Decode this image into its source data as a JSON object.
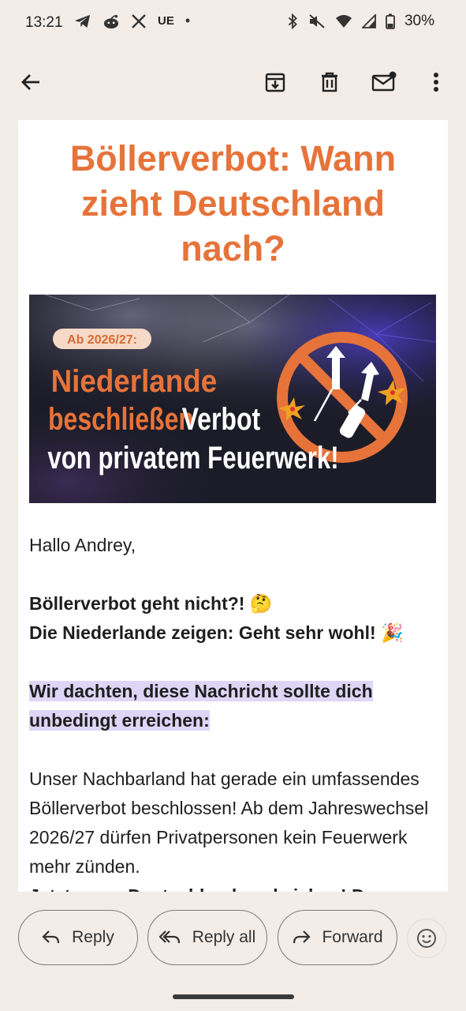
{
  "status_bar": {
    "time": "13:21",
    "carrier_badge": "UE",
    "battery": "30%",
    "icons": [
      "telegram-icon",
      "reddit-icon",
      "x-icon",
      "notification-dot",
      "bluetooth-icon",
      "mute-icon",
      "wifi-icon",
      "signal-icon",
      "battery-icon"
    ]
  },
  "app_bar": {
    "icons": [
      "back-arrow-icon",
      "archive-icon",
      "delete-icon",
      "mark-unread-icon",
      "more-vert-icon"
    ]
  },
  "email": {
    "title": "Böllerverbot: Wann zieht Deutschland nach?",
    "banner": {
      "badge": "Ab 2026/27:",
      "line1": "Niederlande",
      "line2_orange": "beschließen",
      "line2_white": "Verbot",
      "line3": "von privatem Feuerwerk!",
      "accent": "#e6733a"
    },
    "greeting": "Hallo Andrey,",
    "bold1": "Böllerverbot geht nicht?! 🤔",
    "bold2": "Die Niederlande zeigen: Geht sehr wohl! 🎉",
    "highlight": "Wir dachten, diese Nachricht sollte dich unbedingt erreichen:",
    "paragraph": "Unser Nachbarland hat gerade ein umfassendes Böllerverbot beschlossen! Ab dem Jahreswechsel 2026/27 dürfen Privatpersonen kein Feuerwerk mehr zünden.",
    "cut_line": "Jetzt muss Deutschland nachziehen! Do"
  },
  "actions": {
    "reply": "Reply",
    "reply_all": "Reply all",
    "forward": "Forward"
  },
  "colors": {
    "background": "#f3ece7",
    "title": "#e6733a",
    "highlight": "#ddd6f6"
  }
}
